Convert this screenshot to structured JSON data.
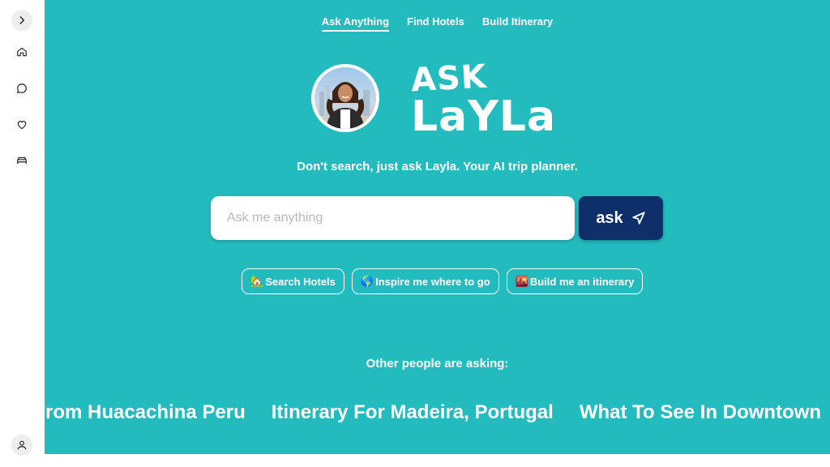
{
  "nav": {
    "tabs": [
      {
        "label": "Ask Anything",
        "active": true
      },
      {
        "label": "Find Hotels",
        "active": false
      },
      {
        "label": "Build Itinerary",
        "active": false
      }
    ]
  },
  "sidebar": {
    "items": [
      {
        "icon": "chevron-right-icon"
      },
      {
        "icon": "home-icon"
      },
      {
        "icon": "chat-bubble-icon"
      },
      {
        "icon": "heart-icon"
      },
      {
        "icon": "bed-icon"
      },
      {
        "icon": "user-icon"
      }
    ]
  },
  "hero": {
    "logo_line1": "ASK",
    "logo_line2": "LaYLa",
    "tagline": "Don't search, just ask Layla. Your AI trip planner."
  },
  "search": {
    "placeholder": "Ask me anything",
    "value": "",
    "button_label": "ask"
  },
  "chips": [
    {
      "emoji": "🏡",
      "label": "Search Hotels"
    },
    {
      "emoji": "🌎",
      "label": "Inspire me where to go"
    },
    {
      "emoji": "🌇",
      "label": "Build me an itinerary"
    }
  ],
  "others": {
    "heading": "Other people are asking:",
    "items": [
      "o From Huacachina Peru",
      "Itinerary For Madeira, Portugal",
      "What To See In Downtown"
    ]
  },
  "colors": {
    "teal_background": "#22bcbf",
    "ask_button": "#0e2f6a",
    "sidebar_bg": "#ffffff"
  }
}
